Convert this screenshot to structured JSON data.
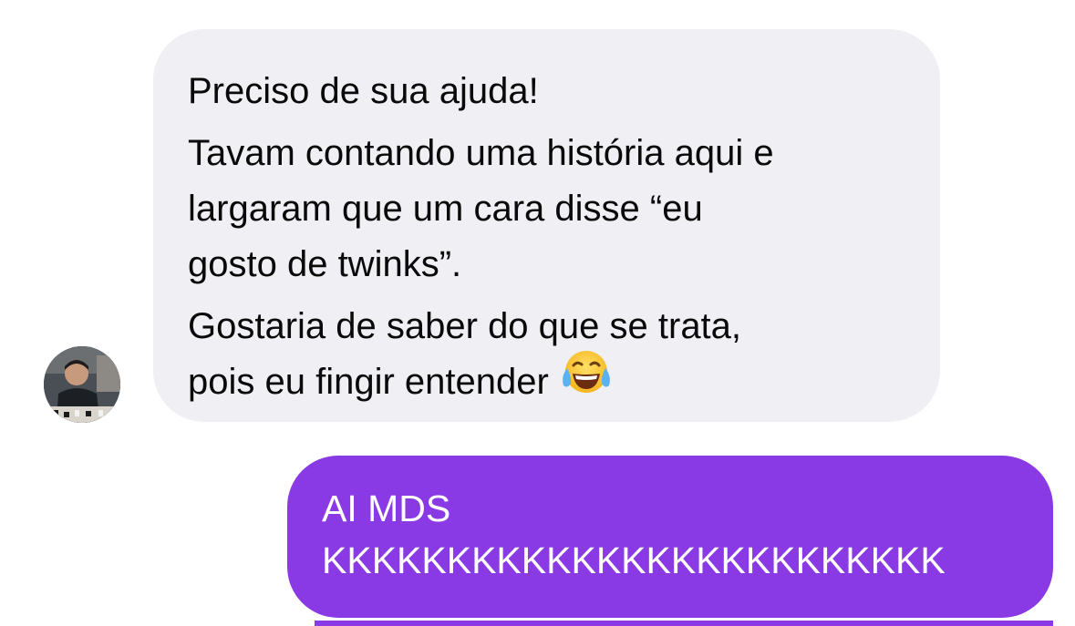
{
  "conversation": {
    "incoming": {
      "avatar_icon": "profile-photo",
      "lines": [
        "Preciso de sua ajuda!",
        "Tavam contando uma história aqui e",
        "largaram que um cara disse “eu",
        "gosto de twinks”.",
        "Gostaria de saber do que se trata,",
        "pois eu fingir entender"
      ],
      "emoji": "face-with-tears-of-joy",
      "bubble_color": "#f0f0f4",
      "text_color": "#0a0a0a"
    },
    "outgoing": {
      "lines": [
        "AI MDS",
        "KKKKKKKKKKKKKKKKKKKKKKKKK"
      ],
      "bubble_color": "#8a3ae4",
      "text_color": "#ffffff"
    }
  }
}
